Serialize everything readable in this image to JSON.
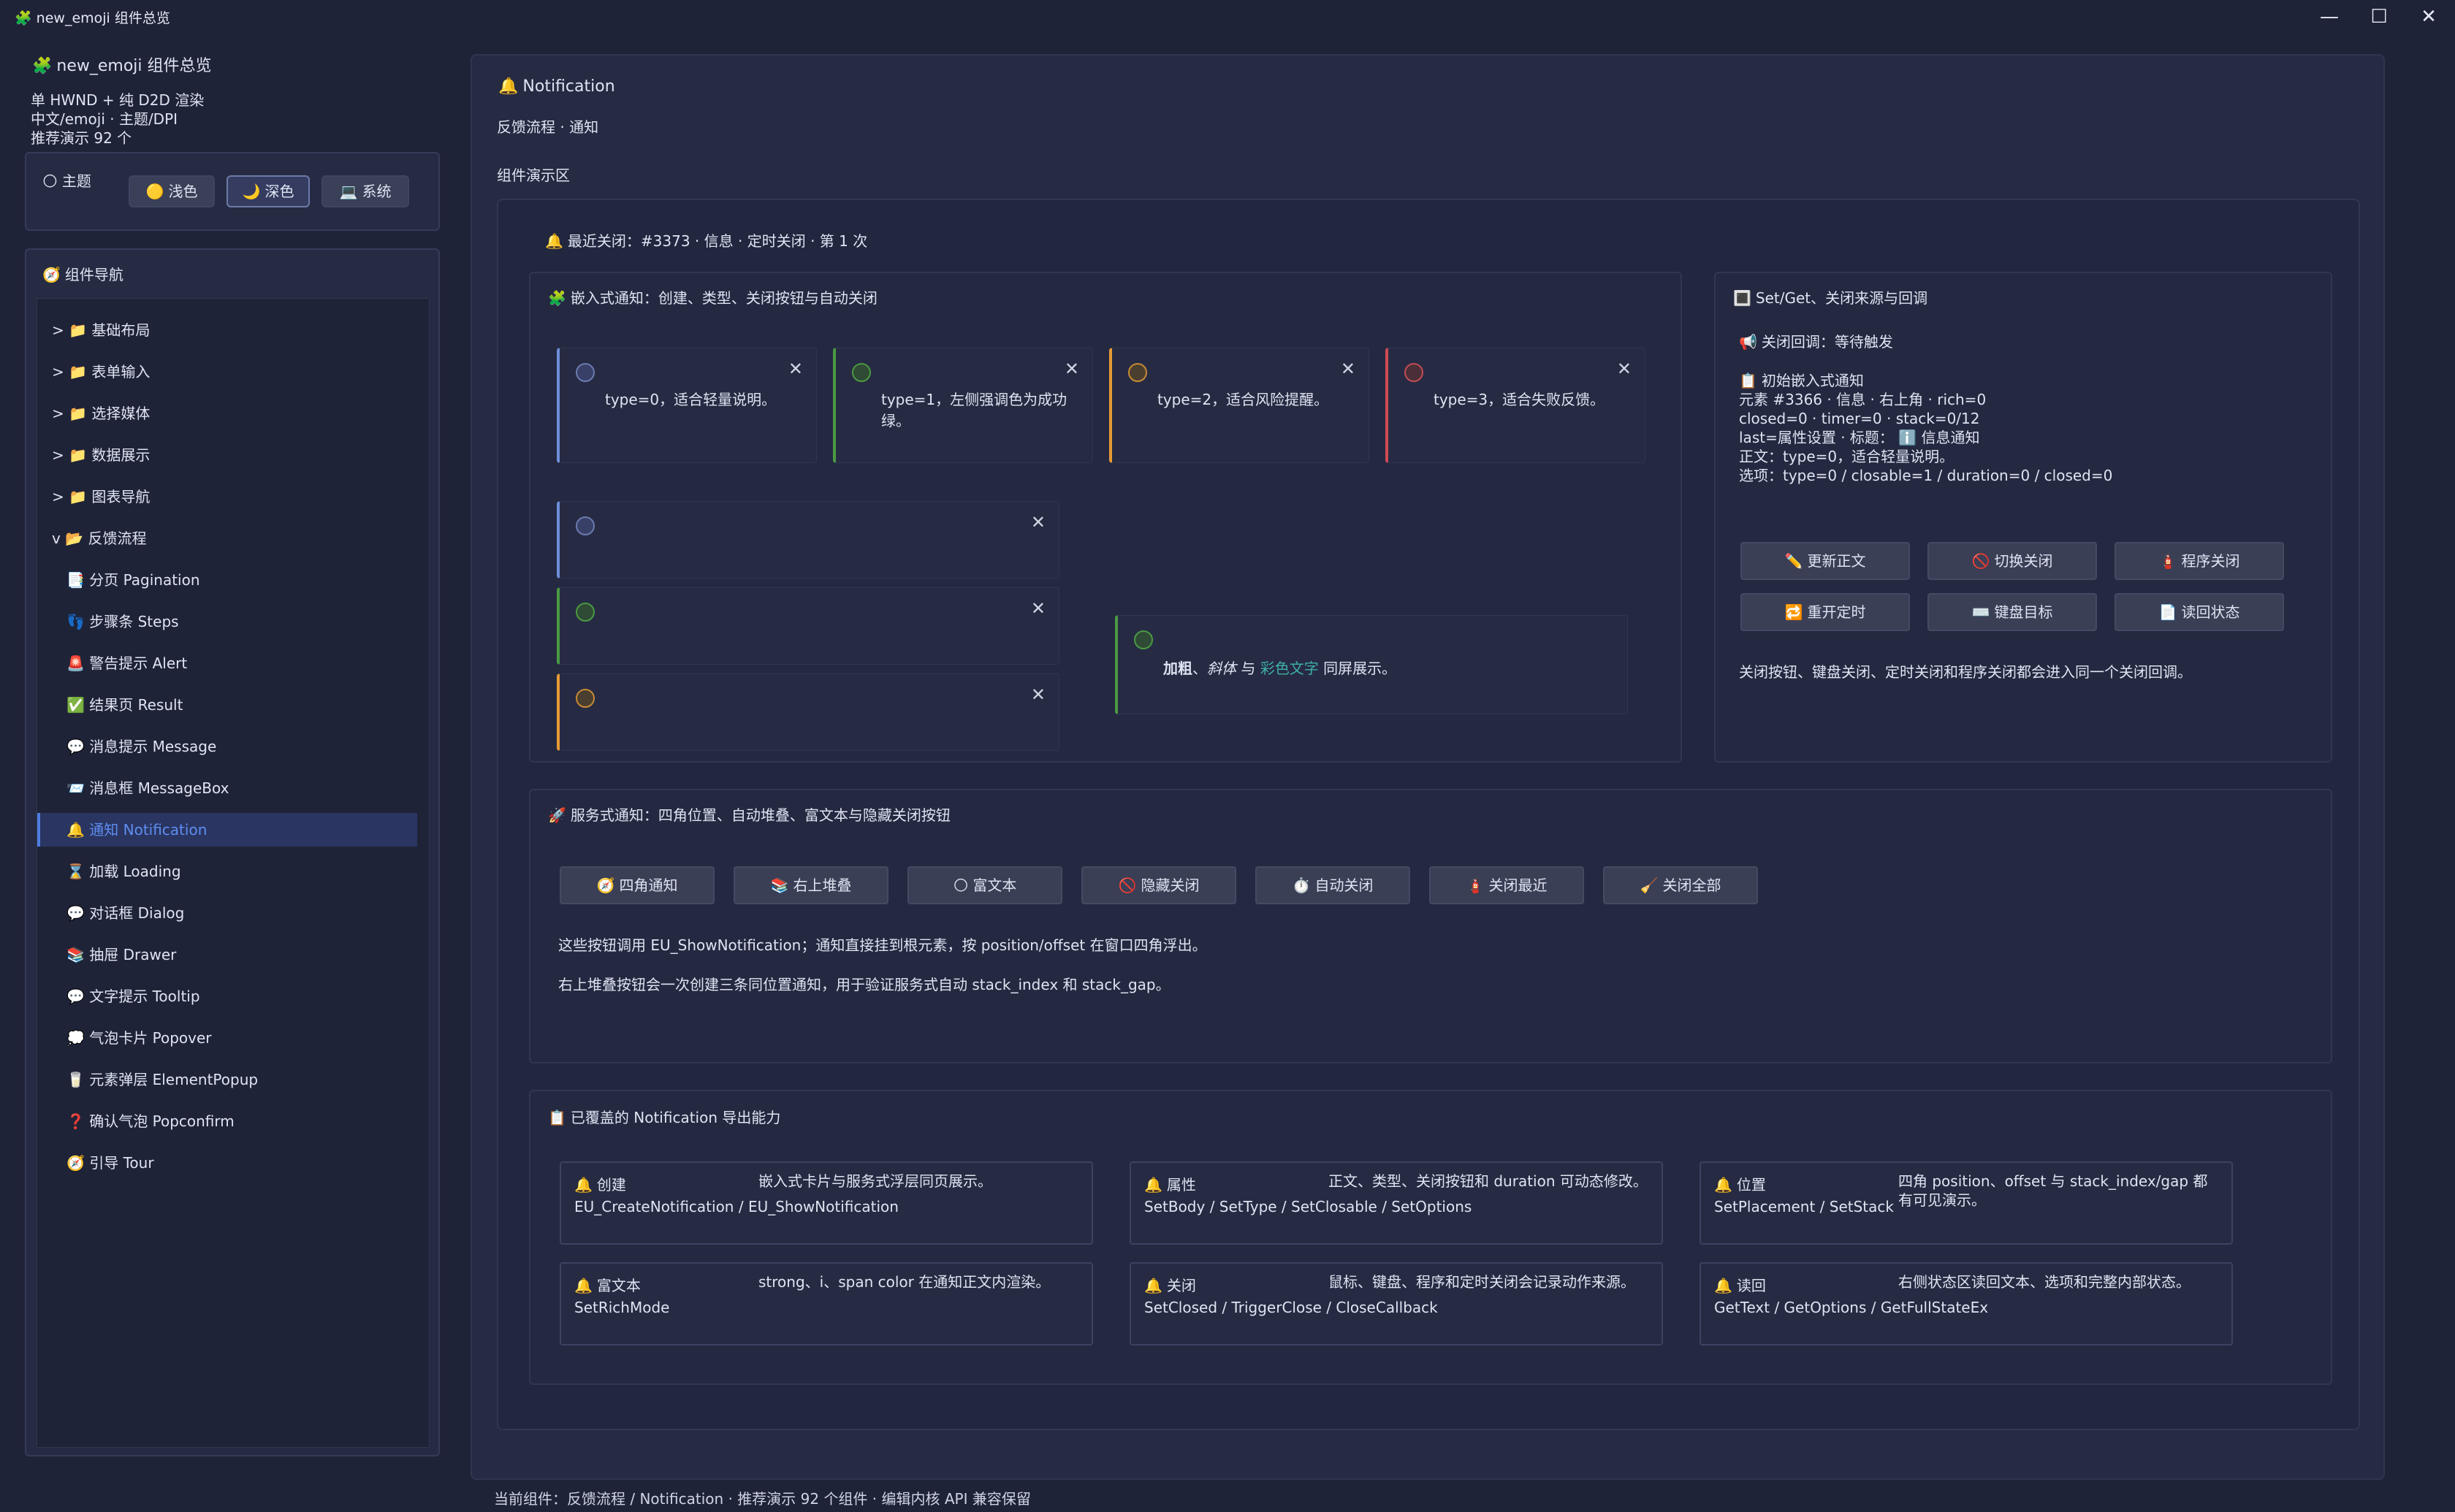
{
  "window": {
    "title": "new_emoji 组件总览",
    "title_icon": "🧩",
    "minimize": "—",
    "maximize": "☐",
    "close": "✕"
  },
  "sidebar": {
    "app_title": "new_emoji 组件总览",
    "app_icon": "🧩",
    "info": [
      "单 HWND + 纯 D2D 渲染",
      "中文/emoji · 主题/DPI",
      "推荐演示 92 个"
    ],
    "theme": {
      "label": "主题",
      "icon": "🌕",
      "options": [
        {
          "label": "浅色",
          "icon": "🟡"
        },
        {
          "label": "深色",
          "icon": "🌙"
        },
        {
          "label": "系统",
          "icon": "💻"
        }
      ]
    },
    "nav": {
      "title": "组件导航",
      "icon": "🧭",
      "items": [
        {
          "label": "> 📁 基础布局"
        },
        {
          "label": "> 📁 表单输入"
        },
        {
          "label": "> 📁 选择媒体"
        },
        {
          "label": "> 📁 数据展示"
        },
        {
          "label": "> 📁 图表导航"
        },
        {
          "label": "v 📂 反馈流程"
        },
        {
          "label": "📑 分页 Pagination"
        },
        {
          "label": "👣 步骤条 Steps"
        },
        {
          "label": "🚨 警告提示 Alert"
        },
        {
          "label": "✅ 结果页 Result"
        },
        {
          "label": "💬 消息提示 Message"
        },
        {
          "label": "📨 消息框 MessageBox"
        },
        {
          "label": "🔔 通知 Notification"
        },
        {
          "label": "⌛ 加载 Loading"
        },
        {
          "label": "💬 对话框 Dialog"
        },
        {
          "label": "📚 抽屉 Drawer"
        },
        {
          "label": "💬 文字提示 Tooltip"
        },
        {
          "label": "💭 气泡卡片 Popover"
        },
        {
          "label": "🥛 元素弹层 ElementPopup"
        },
        {
          "label": "❓ 确认气泡 Popconfirm"
        },
        {
          "label": "🧭 引导 Tour"
        }
      ]
    }
  },
  "main": {
    "title": "Notification",
    "title_icon": "🔔",
    "subtitle": "反馈流程 · 通知",
    "demo_label": "组件演示区",
    "last_closed": "最近关闭：#3373 · 信息 · 定时关闭 · 第 1 次",
    "embedded": {
      "title": "嵌入式通知：创建、类型、关闭按钮与自动关闭",
      "icon": "🧩",
      "cards": [
        {
          "text": "type=0，适合轻量说明。"
        },
        {
          "text": "type=1，左侧强调色为成功绿。"
        },
        {
          "text": "type=2，适合风险提醒。"
        },
        {
          "text": "type=3，适合失败反馈。"
        }
      ],
      "close_glyph": "✕",
      "rich": {
        "bold": "加粗",
        "sep1": "、",
        "italic": "斜体",
        "sep2": " 与 ",
        "color": "彩色文字",
        "tail": " 同屏展示。"
      }
    },
    "setget": {
      "title": "Set/Get、关闭来源与回调",
      "icon": "🔳",
      "callback": "关闭回调：等待触发",
      "callback_icon": "📢",
      "state_head": "初始嵌入式通知",
      "state_icon": "📋",
      "state_lines": [
        "元素 #3366 · 信息 · 右上角 · rich=0",
        "closed=0 · timer=0 · stack=0/12",
        "last=属性设置 · 标题： ℹ️ 信息通知",
        "正文：type=0，适合轻量说明。",
        "选项：type=0 / closable=1 / duration=0 / closed=0"
      ],
      "buttons": [
        {
          "label": "更新正文",
          "icon": "✏️"
        },
        {
          "label": "切换关闭",
          "icon": "🚫"
        },
        {
          "label": "程序关闭",
          "icon": "🧯"
        },
        {
          "label": "重开定时",
          "icon": "🔁"
        },
        {
          "label": "键盘目标",
          "icon": "⌨️"
        },
        {
          "label": "读回状态",
          "icon": "📄"
        }
      ],
      "note": "关闭按钮、键盘关闭、定时关闭和程序关闭都会进入同一个关闭回调。"
    },
    "service": {
      "title": "服务式通知：四角位置、自动堆叠、富文本与隐藏关闭按钮",
      "icon": "🚀",
      "buttons": [
        {
          "label": "四角通知",
          "icon": "🧭"
        },
        {
          "label": "右上堆叠",
          "icon": "📚"
        },
        {
          "label": "富文本",
          "icon": "🌕"
        },
        {
          "label": "隐藏关闭",
          "icon": "🚫"
        },
        {
          "label": "自动关闭",
          "icon": "⏱️"
        },
        {
          "label": "关闭最近",
          "icon": "🧯"
        },
        {
          "label": "关闭全部",
          "icon": "🧹"
        }
      ],
      "desc1": "这些按钮调用 EU_ShowNotification；通知直接挂到根元素，按 position/offset 在窗口四角浮出。",
      "desc2": "右上堆叠按钮会一次创建三条同位置通知，用于验证服务式自动 stack_index 和 stack_gap。"
    },
    "covered": {
      "title": "已覆盖的 Notification 导出能力",
      "icon": "📋",
      "items": [
        {
          "title": "创建",
          "desc": "嵌入式卡片与服务式浮层同页展示。",
          "api": "EU_CreateNotification / EU_ShowNotification"
        },
        {
          "title": "属性",
          "desc": "正文、类型、关闭按钮和 duration 可动态修改。",
          "api": "SetBody / SetType / SetClosable / SetOptions"
        },
        {
          "title": "位置",
          "desc": "四角 position、offset 与 stack_index/gap 都有可见演示。",
          "api": "SetPlacement / SetStack"
        },
        {
          "title": "富文本",
          "desc": "strong、i、span color 在通知正文内渲染。",
          "api": "SetRichMode"
        },
        {
          "title": "关闭",
          "desc": "鼠标、键盘、程序和定时关闭会记录动作来源。",
          "api": "SetClosed / TriggerClose / CloseCallback"
        },
        {
          "title": "读回",
          "desc": "右侧状态区读回文本、选项和完整内部状态。",
          "api": "GetText / GetOptions / GetFullStateEx"
        }
      ],
      "item_icon": "🔔"
    }
  },
  "status": "当前组件：反馈流程 / Notification · 推荐演示 92 个组件 · 编辑内核 API 兼容保留",
  "colors": {
    "accent": "#4f7de0",
    "success": "#4a9a42",
    "warning": "#e89a35",
    "danger": "#d24a53",
    "info": "#6f8fdc"
  }
}
